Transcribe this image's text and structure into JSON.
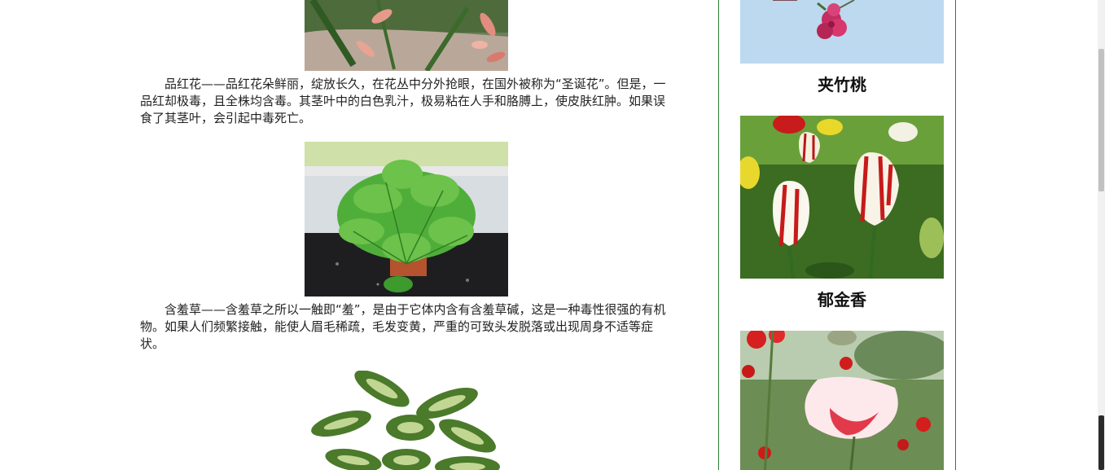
{
  "main": {
    "paragraphs": [
      "品红花——品红花朵鲜丽，绽放长久，在花丛中分外抢眼，在国外被称为“圣诞花”。但是，一品红却极毒，且全株均含毒。其茎叶中的白色乳汁，极易粘在人手和胳膊上，使皮肤红肿。如果误食了其茎叶，会引起中毒死亡。",
      "含羞草——含羞草之所以一触即“羞”，是由于它体内含有含羞草碱，这是一种毒性很强的有机物。如果人们频繁接触，能使人眉毛稀疏，毛发变黄，严重的可致头发脱落或出现周身不适等症状。"
    ],
    "images": [
      {
        "name": "orchid-photo"
      },
      {
        "name": "mimosa-photo"
      },
      {
        "name": "dieffenbachia-photo"
      }
    ]
  },
  "sidebar": {
    "captions": [
      "夹竹桃",
      "郁金香"
    ],
    "images": [
      {
        "name": "oleander-photo"
      },
      {
        "name": "tulip-photo"
      },
      {
        "name": "poppy-photo"
      }
    ]
  },
  "colors": {
    "sidebar_border": "#2e7d32"
  }
}
